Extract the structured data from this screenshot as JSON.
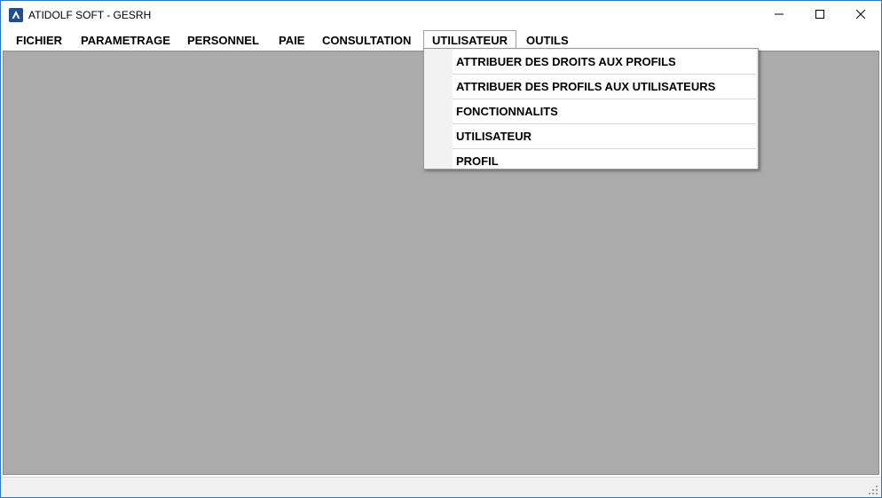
{
  "window": {
    "title": "ATIDOLF SOFT - GESRH",
    "controls": [
      "minimize-icon",
      "maximize-icon",
      "close-icon"
    ]
  },
  "menubar": {
    "items": [
      {
        "label": "FICHIER"
      },
      {
        "label": "PARAMETRAGE"
      },
      {
        "label": "PERSONNEL"
      },
      {
        "label": "PAIE"
      },
      {
        "label": "CONSULTATION"
      },
      {
        "label": "UTILISATEUR",
        "active": true
      },
      {
        "label": "OUTILS"
      }
    ]
  },
  "dropdown": {
    "items": [
      {
        "label": "ATTRIBUER DES DROITS AUX PROFILS"
      },
      {
        "label": "ATTRIBUER DES PROFILS AUX UTILISATEURS"
      },
      {
        "label": "FONCTIONNALITS"
      },
      {
        "label": "UTILISATEUR"
      },
      {
        "label": "PROFIL"
      }
    ]
  },
  "colors": {
    "client_background": "#ababab",
    "titlebar": "#ffffff",
    "window_border": "#2b78c6"
  }
}
